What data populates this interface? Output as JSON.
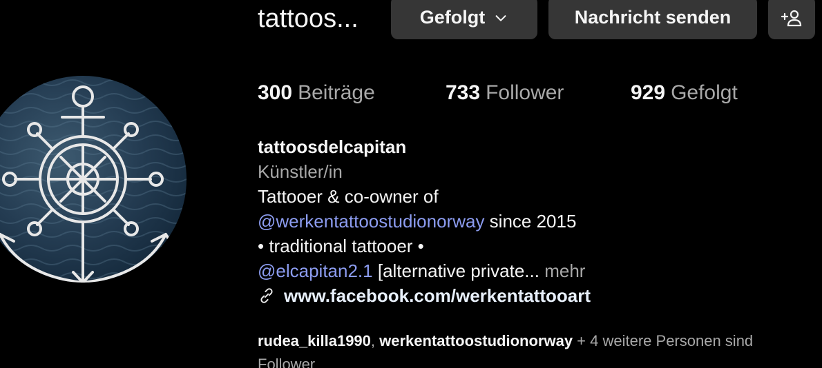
{
  "profile": {
    "username_truncated": "tattoos...",
    "buttons": {
      "following": "Gefolgt",
      "message": "Nachricht senden",
      "add_user_icon": "add-person-icon"
    },
    "stats": {
      "posts_count": "300",
      "posts_label": "Beiträge",
      "followers_count": "733",
      "followers_label": "Follower",
      "following_count": "929",
      "following_label": "Gefolgt"
    },
    "bio": {
      "name": "tattoosdelcapitan",
      "category": "Künstler/in",
      "line1": "Tattooer & co-owner of",
      "line2_link": "@werkentattoostudionorway",
      "line2_rest": " since 2015",
      "line3": "• traditional tattooer •",
      "line4_link": "@elcapitan2.1",
      "line4_rest": " [alternative private...",
      "more": "mehr",
      "website": "www.facebook.com/werkentattooart"
    },
    "mutuals": {
      "user1": "rudea_killa1990",
      "separator": ", ",
      "user2": "werkentattoostudionorway",
      "rest": " + 4 weitere Personen sind",
      "line2": "Follower"
    }
  },
  "colors": {
    "background": "#000000",
    "button": "#363636",
    "text": "#f5f5f5",
    "secondary_text": "#a8a8a8",
    "link": "#8c9cf0"
  }
}
